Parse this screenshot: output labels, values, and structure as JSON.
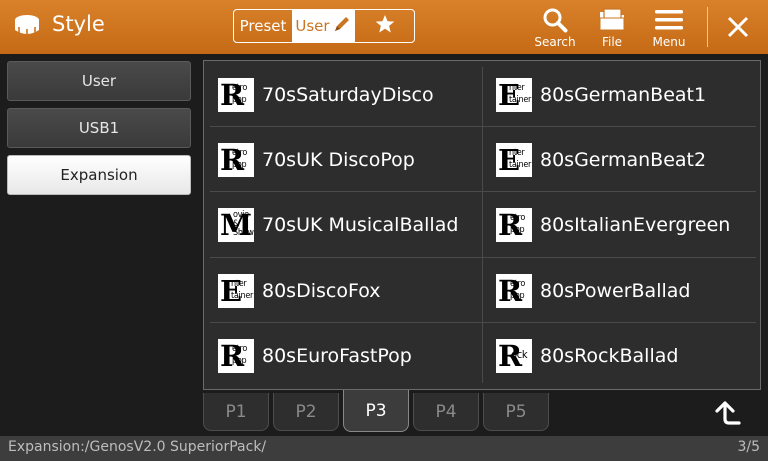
{
  "header": {
    "title": "Style",
    "title_icon": "style-drum-icon",
    "segments": {
      "preset": "Preset",
      "user": "User",
      "favorite": "favorite-star-icon"
    },
    "tools": [
      {
        "label": "Search",
        "icon": "search-icon"
      },
      {
        "label": "File",
        "icon": "folder-icon"
      },
      {
        "label": "Menu",
        "icon": "menu-icon"
      }
    ],
    "close_icon": "close-icon"
  },
  "sidebar": {
    "items": [
      {
        "label": "User",
        "active": false
      },
      {
        "label": "USB1",
        "active": false
      },
      {
        "label": "Expansion",
        "active": true
      }
    ]
  },
  "browser": {
    "left_column": [
      {
        "name": "70sSaturdayDisco",
        "category": {
          "big": "R",
          "lines": [
            "etro",
            "pop"
          ]
        }
      },
      {
        "name": "70sUK DiscoPop",
        "category": {
          "big": "R",
          "lines": [
            "etro",
            "pop"
          ]
        }
      },
      {
        "name": "70sUK MusicalBallad",
        "category": {
          "big": "M",
          "lines": [
            "ovie",
            "&",
            "Show"
          ]
        }
      },
      {
        "name": "80sDiscoFox",
        "category": {
          "big": "E",
          "lines": [
            "nter",
            "tainer"
          ]
        }
      },
      {
        "name": "80sEuroFastPop",
        "category": {
          "big": "R",
          "lines": [
            "etro",
            "pop"
          ]
        }
      }
    ],
    "right_column": [
      {
        "name": "80sGermanBeat1",
        "category": {
          "big": "E",
          "lines": [
            "nter",
            "tainer"
          ]
        }
      },
      {
        "name": "80sGermanBeat2",
        "category": {
          "big": "E",
          "lines": [
            "nter",
            "tainer"
          ]
        }
      },
      {
        "name": "80sItalianEvergreen",
        "category": {
          "big": "R",
          "lines": [
            "etro",
            "pop"
          ]
        }
      },
      {
        "name": "80sPowerBallad",
        "category": {
          "big": "R",
          "lines": [
            "etro",
            "pop"
          ]
        }
      },
      {
        "name": "80sRockBallad",
        "category": {
          "big": "R",
          "lines": [
            "ock"
          ]
        }
      }
    ]
  },
  "pages": {
    "tabs": [
      "P1",
      "P2",
      "P3",
      "P4",
      "P5"
    ],
    "active": "P3",
    "up_icon": "up-level-icon"
  },
  "status": {
    "path": "Expansion:/GenosV2.0 SuperiorPack/",
    "page_indicator": "3/5"
  }
}
